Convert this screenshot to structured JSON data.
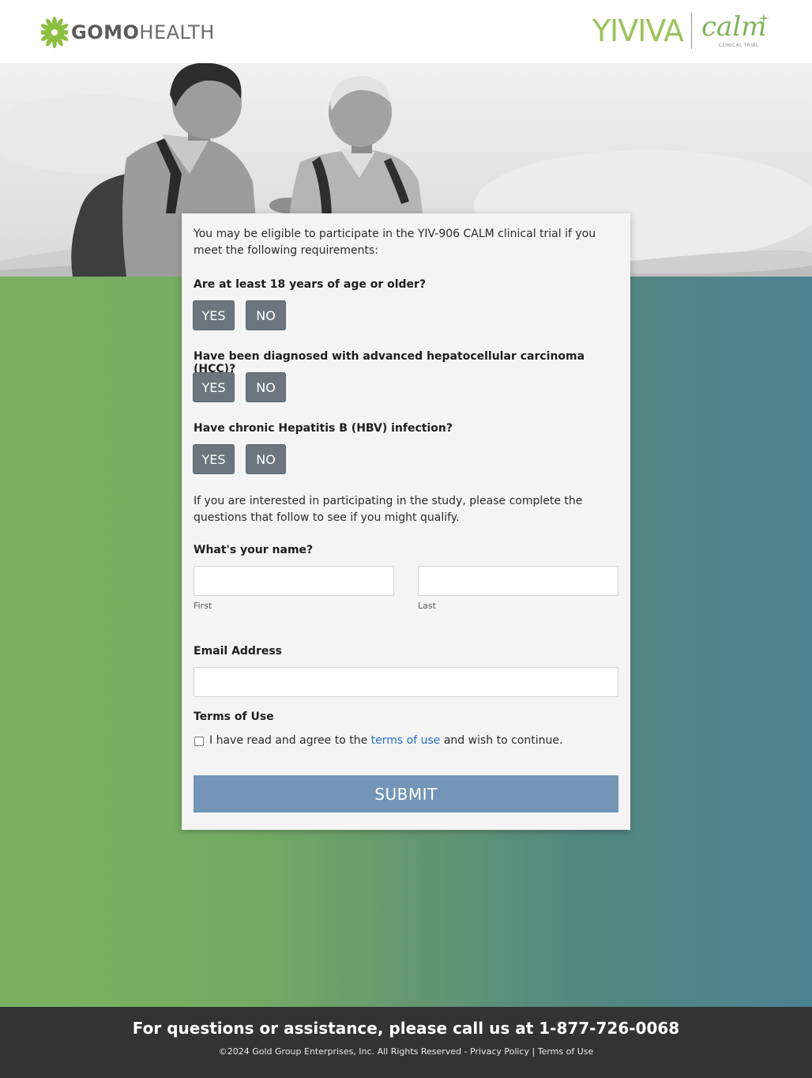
{
  "header": {
    "gomo_logo_bold": "GOMO",
    "gomo_logo_light": "HEALTH",
    "yiviva_logo": "YIVIVA",
    "calm_logo": "calm",
    "calm_sub": "CLINICAL TRIAL"
  },
  "form": {
    "intro": "You may be eligible to participate in the YIV-906 CALM clinical trial if you meet the following requirements:",
    "questions": [
      {
        "label": "Are at least 18 years of age or older?",
        "yes": "YES",
        "no": "NO"
      },
      {
        "label": "Have been diagnosed with advanced hepatocellular carcinoma (HCC)?",
        "yes": "YES",
        "no": "NO"
      },
      {
        "label": "Have chronic Hepatitis B (HBV) infection?",
        "yes": "YES",
        "no": "NO"
      }
    ],
    "interest_text": "If you are interested in participating in the study, please complete the questions that follow to see if you might qualify.",
    "name_label": "What's your name?",
    "first_value": "",
    "last_value": "",
    "first_sublabel": "First",
    "last_sublabel": "Last",
    "email_label": "Email Address",
    "email_value": "",
    "terms_heading": "Terms of Use",
    "terms_pre": "I have read and agree to the ",
    "terms_link": "terms of use",
    "terms_post": " and wish to continue.",
    "terms_checked": false,
    "submit_label": "SUBMIT"
  },
  "footer": {
    "call_text": "For questions or assistance, please call us at 1-877-726-0068",
    "copyright": "©2024 Gold Group Enterprises, Inc. All Rights Reserved - Privacy Policy | Terms of Use"
  },
  "colors": {
    "button_gray": "#6c757d",
    "submit_blue": "#7395b7",
    "link_blue": "#2a6fd0",
    "gradient_left": "#7cb15f",
    "gradient_right": "#4b8290",
    "footer_bg": "#333333",
    "brand_green": "#9cc25b"
  }
}
